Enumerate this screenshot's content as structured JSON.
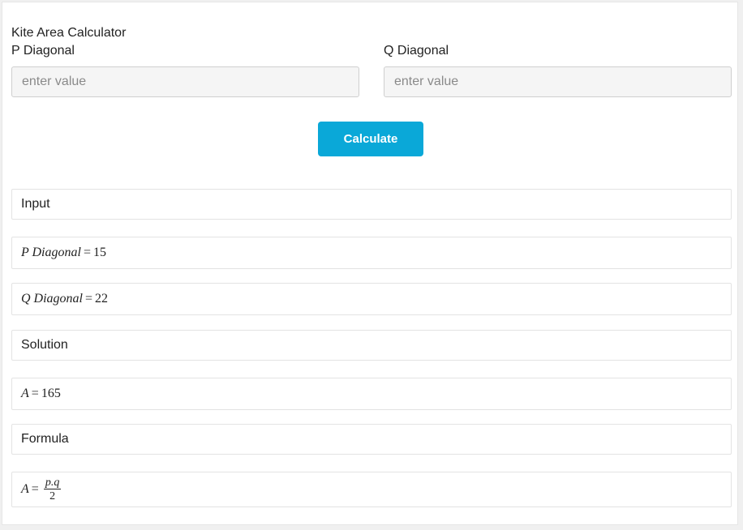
{
  "calculator": {
    "title": "Kite Area Calculator",
    "p_label": "P Diagonal",
    "q_label": "Q Diagonal",
    "p_placeholder": "enter value",
    "q_placeholder": "enter value",
    "calculate_label": "Calculate"
  },
  "results": {
    "input_heading": "Input",
    "p_row": {
      "name": "P Diagonal",
      "value": "15"
    },
    "q_row": {
      "name": "Q Diagonal",
      "value": "22"
    },
    "solution_heading": "Solution",
    "solution_row": {
      "name": "A",
      "value": "165"
    },
    "formula_heading": "Formula",
    "formula_row": {
      "name": "A",
      "numerator": "p.q",
      "denominator": "2"
    }
  },
  "colors": {
    "button": "#0aa8d8"
  }
}
